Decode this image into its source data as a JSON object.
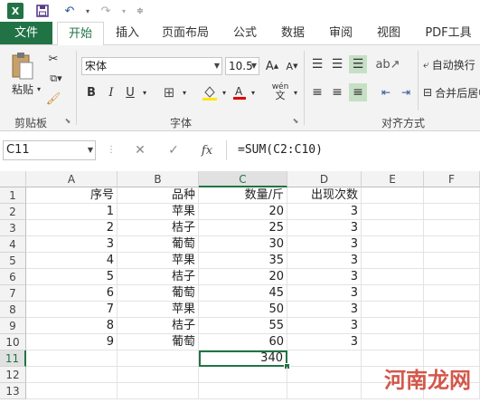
{
  "quick_access": {
    "icons": [
      "excel-logo-icon",
      "save-icon",
      "undo-icon",
      "redo-icon",
      "customize-icon"
    ]
  },
  "tabs": [
    {
      "label": "文件"
    },
    {
      "label": "开始"
    },
    {
      "label": "插入"
    },
    {
      "label": "页面布局"
    },
    {
      "label": "公式"
    },
    {
      "label": "数据"
    },
    {
      "label": "审阅"
    },
    {
      "label": "视图"
    },
    {
      "label": "PDF工具"
    }
  ],
  "ribbon": {
    "paste_label": "粘贴",
    "clipboard_label": "剪贴板",
    "font_name": "宋体",
    "font_size": "10.5",
    "bold": "B",
    "italic": "I",
    "underline": "U",
    "font_group_label": "字体",
    "wen_label": "wén",
    "align_group_label": "对齐方式",
    "wrap_label": "自动换行",
    "merge_label": "合并后居中",
    "accent_color": "#217346"
  },
  "formula_bar": {
    "name_box": "C11",
    "formula": "=SUM(C2:C10)",
    "fx": "fx"
  },
  "columns": [
    "A",
    "B",
    "C",
    "D",
    "E",
    "F"
  ],
  "selected_column": "C",
  "rows": [
    "1",
    "2",
    "3",
    "4",
    "5",
    "6",
    "7",
    "8",
    "9",
    "10",
    "11",
    "12",
    "13"
  ],
  "selected_row": "11",
  "table": {
    "headers": [
      "序号",
      "品种",
      "数量/斤",
      "出现次数"
    ],
    "data": [
      [
        "1",
        "苹果",
        "20",
        "3"
      ],
      [
        "2",
        "桔子",
        "25",
        "3"
      ],
      [
        "3",
        "葡萄",
        "30",
        "3"
      ],
      [
        "4",
        "苹果",
        "35",
        "3"
      ],
      [
        "5",
        "桔子",
        "20",
        "3"
      ],
      [
        "6",
        "葡萄",
        "45",
        "3"
      ],
      [
        "7",
        "苹果",
        "50",
        "3"
      ],
      [
        "8",
        "桔子",
        "55",
        "3"
      ],
      [
        "9",
        "葡萄",
        "60",
        "3"
      ]
    ],
    "sum": "340"
  },
  "watermark": "河南龙网"
}
